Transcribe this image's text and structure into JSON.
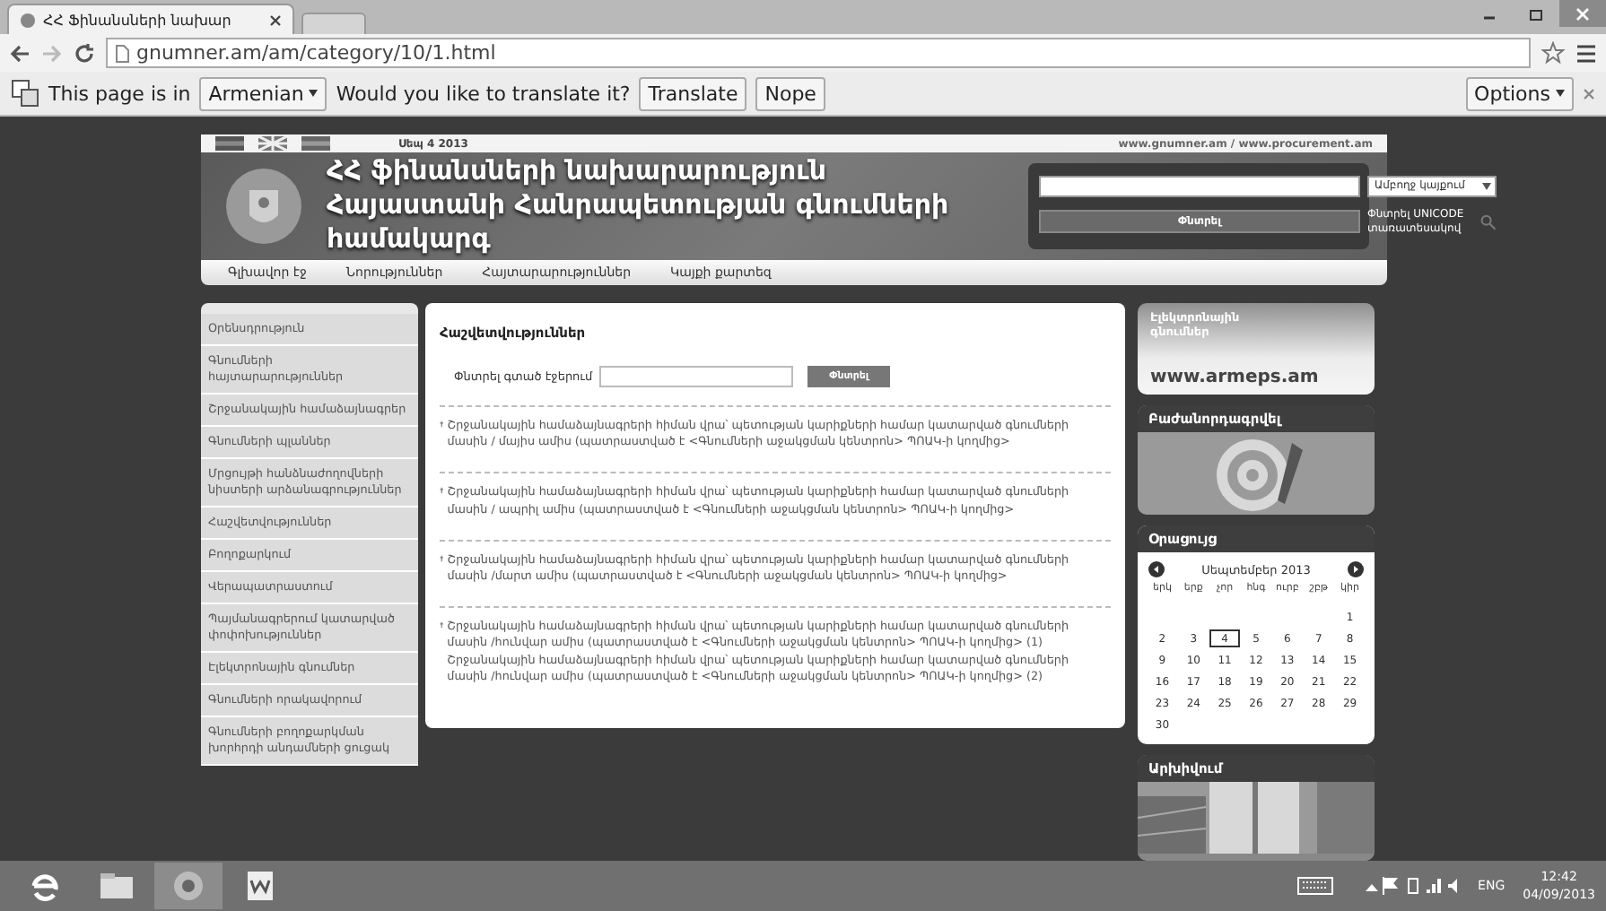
{
  "browser": {
    "tab_title": "ՀՀ Ֆինանսների նախար",
    "url": "gnumner.am/am/category/10/1.html",
    "translate_bar": {
      "prefix": "This page is in",
      "language": "Armenian",
      "question": "Would you like to translate it?",
      "buttons": [
        "Translate",
        "Nope"
      ],
      "options": "Options"
    }
  },
  "site": {
    "date": "Սեպ 4 2013",
    "links": "www.gnumner.am / www.procurement.am",
    "title_lines": [
      "ՀՀ ֆինանսների նախարարություն",
      "Հայաստանի Հանրապետության գնումների",
      "համակարգ"
    ],
    "search": {
      "scope": "Ամբողջ կայքում",
      "button": "Փնտրել",
      "unicode_link": "Փնտրել UNICODE տառատեսակով"
    },
    "nav": [
      "Գլխավոր էջ",
      "Նորություններ",
      "Հայտարարություններ",
      "Կայքի քարտեզ"
    ],
    "sidebar": [
      "Օրենսդրություն",
      "Գնումների հայտարարություններ",
      "Շրջանակային համաձայնագրեր",
      "Գնումների պլաններ",
      "Մրցույթի հանձնաժողովների նիստերի արձանագրություններ",
      "Հաշվետվություններ",
      "Բողոքարկում",
      "Վերապատրաստում",
      "Պայմանագրերում կատարված փոփոխություններ",
      "Էլեկտրոնային գնումներ",
      "Գնումների որակավորում",
      "Գնումների բողոքարկման խորհրդի անդամների ցուցակ"
    ],
    "main": {
      "heading": "Հաշվետվություններ",
      "search_label": "Փնտրել գտած էջերում",
      "search_button": "Փնտրել",
      "entries": [
        [
          "Շրջանակային համաձայնագրերի հիման վրա՝ պետության կարիքների համար կատարված գնումների մասին / մայիս ամիս (պատրաստված է <Գնումների աջակցման կենտրոն> ՊՈԱԿ-ի կողմից>"
        ],
        [
          "Շրջանակային համաձայնագրերի հիման վրա՝ պետության կարիքների համար կատարված գնումների մասին / ապրիլ ամիս (պատրաստված է <Գնումների աջակցման կենտրոն> ՊՈԱԿ-ի կողմից>"
        ],
        [
          "Շրջանակային համաձայնագրերի հիման վրա՝ պետության կարիքների համար կատարված գնումների մասին /մարտ ամիս (պատրաստված է <Գնումների աջակցման կենտրոն> ՊՈԱԿ-ի կողմից>"
        ],
        [
          "Շրջանակային համաձայնագրերի հիման վրա՝ պետության կարիքների համար կատարված գնումների մասին /հունվար ամիս (պատրաստված է <Գնումների աջակցման կենտրոն> ՊՈԱԿ-ի կողմից> (1)",
          "Շրջանակային համաձայնագրերի հիման վրա՝ պետության կարիքների համար կատարված գնումների մասին /հունվար ամիս (պատրաստված է <Գնումների աջակցման կենտրոն> ՊՈԱԿ-ի կողմից> (2)"
        ]
      ]
    },
    "eprocurement": {
      "title": "Էլեկտրոնային գնումներ",
      "url": "www.armeps.am"
    },
    "subscribe": {
      "title": "Բաժանորդագրվել"
    },
    "calendar": {
      "title": "Օրացույց",
      "month": "Սեպտեմբեր 2013",
      "weekdays": [
        "երկ",
        "երք",
        "չոր",
        "հնգ",
        "ուրբ",
        "շբթ",
        "կիր"
      ],
      "weeks": [
        [
          {
            "day": "1",
            "selected": false
          }
        ],
        [
          {
            "day": "2",
            "selected": false
          },
          {
            "day": "3",
            "selected": false
          },
          {
            "day": "4",
            "selected": true
          },
          {
            "day": "5",
            "selected": false
          },
          {
            "day": "6",
            "selected": false
          },
          {
            "day": "7",
            "selected": false
          },
          {
            "day": "8",
            "selected": false
          }
        ],
        [
          {
            "day": "9",
            "selected": false
          },
          {
            "day": "10",
            "selected": false
          },
          {
            "day": "11",
            "selected": false
          },
          {
            "day": "12",
            "selected": false
          },
          {
            "day": "13",
            "selected": false
          },
          {
            "day": "14",
            "selected": false
          },
          {
            "day": "15",
            "selected": false
          }
        ],
        [
          {
            "day": "16",
            "selected": false
          },
          {
            "day": "17",
            "selected": false
          },
          {
            "day": "18",
            "selected": false
          },
          {
            "day": "19",
            "selected": false
          },
          {
            "day": "20",
            "selected": false
          },
          {
            "day": "21",
            "selected": false
          },
          {
            "day": "22",
            "selected": false
          }
        ],
        [
          {
            "day": "23",
            "selected": false
          },
          {
            "day": "24",
            "selected": false
          },
          {
            "day": "25",
            "selected": false
          },
          {
            "day": "26",
            "selected": false
          },
          {
            "day": "27",
            "selected": false
          },
          {
            "day": "28",
            "selected": false
          },
          {
            "day": "29",
            "selected": false
          }
        ],
        [
          {
            "day": "30",
            "selected": false
          }
        ]
      ]
    },
    "archive": {
      "title": "Արխիվում"
    }
  },
  "taskbar": {
    "language": "ENG",
    "time": "12:42",
    "date": "04/09/2013"
  }
}
